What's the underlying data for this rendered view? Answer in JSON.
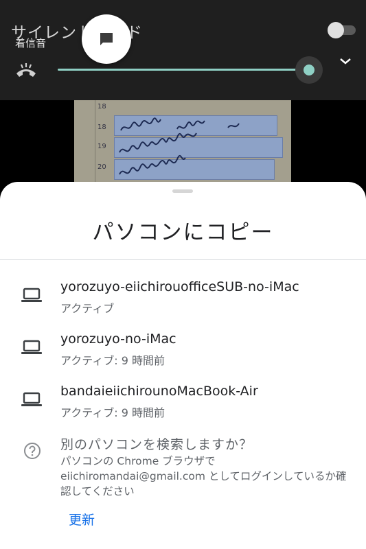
{
  "volume_panel": {
    "mode_label": "サイレントモード",
    "stream_label": "着信音",
    "ringer_volume_percent": 100,
    "silent_mode_toggle": "off",
    "accent_color": "#8fd0c5",
    "icons": {
      "chat": "chat-bubble-icon",
      "ringer": "ringer-icon",
      "expand": "chevron-down-icon"
    }
  },
  "sheet": {
    "title": "パソコンにコピー",
    "devices": [
      {
        "name": "yorozuyo-eiichirouofficeSUB-no-iMac",
        "status": "アクティブ",
        "icon": "laptop-icon"
      },
      {
        "name": "yorozuyo-no-iMac",
        "status": "アクティブ: 9 時間前",
        "icon": "laptop-icon"
      },
      {
        "name": "bandaieiichirounoMacBook-Air",
        "status": "アクティブ: 9 時間前",
        "icon": "laptop-icon"
      }
    ],
    "help": {
      "icon": "help-icon",
      "title": "別のパソコンを検索しますか？",
      "body": "パソコンの Chrome ブラウザで eiichiromandai@gmail.com としてログインしているか確認してください"
    },
    "refresh_label": "更新",
    "link_color": "#1a73e8"
  }
}
